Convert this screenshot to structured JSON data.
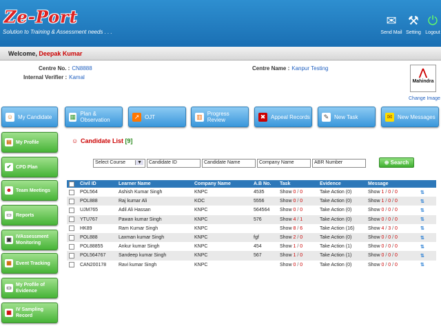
{
  "header": {
    "logo_text": "Ze-Port",
    "tagline": "Solution to Training & Assessment needs . . .",
    "buttons": [
      {
        "label": "Send Mail",
        "icon": "envelope-icon"
      },
      {
        "label": "Setting",
        "icon": "tools-icon"
      },
      {
        "label": "Logout",
        "icon": "power-icon"
      }
    ]
  },
  "welcome": {
    "prefix": "Welcome,",
    "name": "Deepak Kumar"
  },
  "info": {
    "centre_no_label": "Centre No. :",
    "centre_no": "CN8888",
    "centre_name_label": "Centre Name :",
    "centre_name": "Kanpur Testing",
    "verifier_label": "Internal Verifier :",
    "verifier": "Kamal",
    "logo_brand": "Mahindra",
    "change_image": "Change Image"
  },
  "top_nav": [
    "My Candidate",
    "Plan & Observation",
    "OJT",
    "Progress Review",
    "Appeal Records",
    "New Task",
    "New Messages"
  ],
  "side_nav": [
    "My Profile",
    "CPD Plan",
    "Team Meetings",
    "Reports",
    "IVAssessment Monitoring",
    "Event Tracking",
    "My Profile of Evidence",
    "IV Sampling Record"
  ],
  "list": {
    "title": "Candidate List",
    "count": "[9]"
  },
  "filters": {
    "course": "Select Course",
    "candidate_id": "Candidate ID",
    "candidate_name": "Candidate Name",
    "company_name": "Company Name",
    "abr_number": "ABR Number",
    "search_label": "Search"
  },
  "table": {
    "headers": [
      "Civil ID",
      "Learner Name",
      "Company Name",
      "A.B No.",
      "Task",
      "Evidence",
      "Message"
    ],
    "rows": [
      {
        "id": "POL564",
        "name": "Ashish Kumar Singh",
        "company": "KNPC",
        "ab": "4535",
        "task_show": "Show",
        "task_a": "0",
        "task_b": "0",
        "ev": "Take Action (0)",
        "msg_show": "Show",
        "m1": "1",
        "m2": "0",
        "m3": "0"
      },
      {
        "id": "POL888",
        "name": "Raj kumar Ali",
        "company": "KOC",
        "ab": "5556",
        "task_show": "Show",
        "task_a": "0",
        "task_b": "0",
        "ev": "Take Action (0)",
        "msg_show": "Show",
        "m1": "1",
        "m2": "0",
        "m3": "0"
      },
      {
        "id": "UJM765",
        "name": "Adil Ali Hassan",
        "company": "KNPC",
        "ab": "564564",
        "task_show": "Show",
        "task_a": "0",
        "task_b": "0",
        "ev": "Take Action (0)",
        "msg_show": "Show",
        "m1": "0",
        "m2": "0",
        "m3": "0"
      },
      {
        "id": "YTU767",
        "name": "Pawan kumar Singh",
        "company": "KNPC",
        "ab": "576",
        "task_show": "Show",
        "task_a": "4",
        "task_b": "1",
        "ev": "Take Action (0)",
        "msg_show": "Show",
        "m1": "0",
        "m2": "0",
        "m3": "0"
      },
      {
        "id": "HK89",
        "name": "Ram Kumar Singh",
        "company": "KNPC",
        "ab": "",
        "task_show": "Show",
        "task_a": "8",
        "task_b": "6",
        "ev": "Take Action (16)",
        "msg_show": "Show",
        "m1": "4",
        "m2": "3",
        "m3": "0"
      },
      {
        "id": "POL888",
        "name": "Laxman kumar Singh",
        "company": "KNPC",
        "ab": "fgf",
        "task_show": "Show",
        "task_a": "2",
        "task_b": "0",
        "ev": "Take Action (0)",
        "msg_show": "Show",
        "m1": "0",
        "m2": "0",
        "m3": "0"
      },
      {
        "id": "POL88855",
        "name": "Ankur kumar Singh",
        "company": "KNPC",
        "ab": "454",
        "task_show": "Show",
        "task_a": "1",
        "task_b": "0",
        "ev": "Take Action (1)",
        "msg_show": "Show",
        "m1": "0",
        "m2": "0",
        "m3": "0"
      },
      {
        "id": "POL564767",
        "name": "Sandeep kumar Singh",
        "company": "KNPC",
        "ab": "567",
        "task_show": "Show",
        "task_a": "1",
        "task_b": "0",
        "ev": "Take Action (1)",
        "msg_show": "Show",
        "m1": "0",
        "m2": "0",
        "m3": "0"
      },
      {
        "id": "CAN200178",
        "name": "Ravi kumar Singh",
        "company": "KNPC",
        "ab": "",
        "task_show": "Show",
        "task_a": "0",
        "task_b": "0",
        "ev": "Take Action (0)",
        "msg_show": "Show",
        "m1": "0",
        "m2": "0",
        "m3": "0"
      }
    ]
  }
}
